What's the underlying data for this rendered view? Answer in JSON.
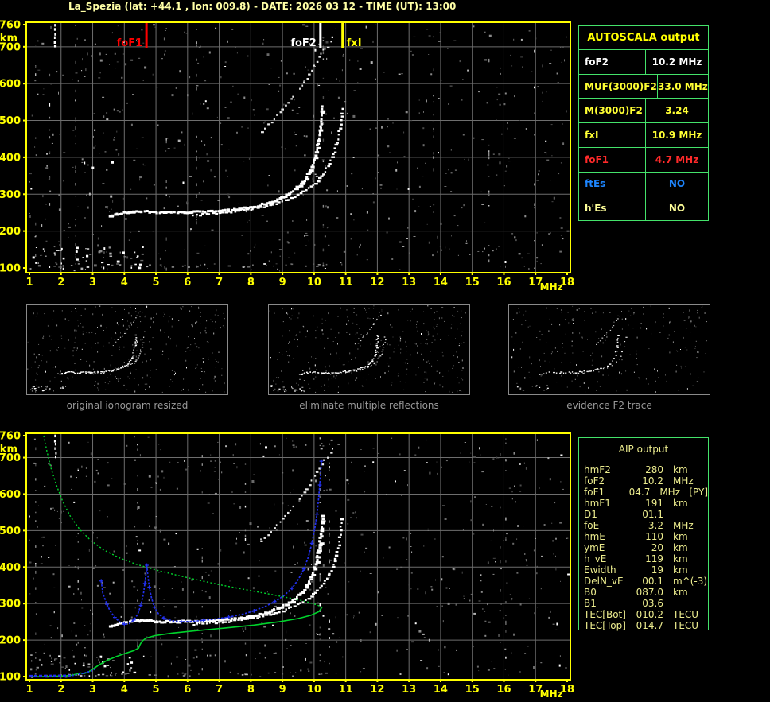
{
  "title": "La_Spezia (lat: +44.1 , lon: 009.8) - DATE: 2026 03 12 - TIME (UT): 13:00",
  "colors": {
    "title": "#ffffa6",
    "axis_labels": "#ffff00",
    "plot_border": "#ffff00",
    "grid": "#6e6e6e",
    "noise_palette": [
      "#4a4a4a",
      "#6a6a6a",
      "#8a8a8a",
      "#b4b4b4",
      "#ffffff"
    ],
    "trace_white": "#ffffff",
    "profile_green": "#00d42c",
    "scaled_trace_blue": "#2230ee",
    "table_border_green": "#44e26a",
    "caption_gray": "#9a9a9a"
  },
  "autoscala_table": {
    "title": "AUTOSCALA output",
    "rows": [
      {
        "label": "foF2",
        "value": "10.2 MHz",
        "color": "#ffffff"
      },
      {
        "label": "MUF(3000)F2",
        "value": "33.0 MHz",
        "color": "#ffff33"
      },
      {
        "label": "M(3000)F2",
        "value": "3.24",
        "color": "#ffff33"
      },
      {
        "label": "fxI",
        "value": "10.9 MHz",
        "color": "#ffff33"
      },
      {
        "label": "foF1",
        "value": "4.7 MHz",
        "color": "#ff2a2a"
      },
      {
        "label": "ftEs",
        "value": "NO",
        "color": "#1e86ff"
      },
      {
        "label": "h'Es",
        "value": "NO",
        "color": "#ffff99"
      }
    ]
  },
  "aip_table": {
    "title": "AIP output",
    "rows": [
      {
        "label": "hmF2",
        "value": "280",
        "unit": "km",
        "note": ""
      },
      {
        "label": "foF2",
        "value": "10.2",
        "unit": "MHz",
        "note": ""
      },
      {
        "label": "foF1",
        "value": "04.7",
        "unit": "MHz",
        "note": "[PY]"
      },
      {
        "label": "hmF1",
        "value": "191",
        "unit": "km",
        "note": ""
      },
      {
        "label": "D1",
        "value": "01.1",
        "unit": "",
        "note": ""
      },
      {
        "label": "foE",
        "value": "3.2",
        "unit": "MHz",
        "note": ""
      },
      {
        "label": "hmE",
        "value": "110",
        "unit": "km",
        "note": ""
      },
      {
        "label": "ymE",
        "value": "20",
        "unit": "km",
        "note": ""
      },
      {
        "label": "h_vE",
        "value": "119",
        "unit": "km",
        "note": ""
      },
      {
        "label": "Ewidth",
        "value": "19",
        "unit": "km",
        "note": ""
      },
      {
        "label": "DelN_vE",
        "value": "00.1",
        "unit": "m^(-3)",
        "note": ""
      },
      {
        "label": "B0",
        "value": "087.0",
        "unit": "km",
        "note": ""
      },
      {
        "label": "B1",
        "value": "03.6",
        "unit": "",
        "note": ""
      },
      {
        "label": "TEC[Bot]",
        "value": "010.2",
        "unit": "TECU",
        "note": ""
      },
      {
        "label": "TEC[Top]",
        "value": "014.7",
        "unit": "TECU",
        "note": ""
      }
    ]
  },
  "thumbnails": [
    {
      "caption": "original ionogram resized"
    },
    {
      "caption": "eliminate multiple reflections"
    },
    {
      "caption": "evidence F2 trace"
    }
  ],
  "axes": {
    "x_ticks": [
      "1",
      "2",
      "3",
      "4",
      "5",
      "6",
      "7",
      "8",
      "9",
      "10",
      "11",
      "12",
      "13",
      "14",
      "15",
      "16",
      "17",
      "18"
    ],
    "x_unit": "MHz",
    "y_ticks": [
      "760",
      "700",
      "600",
      "500",
      "400",
      "300",
      "200",
      "100"
    ],
    "y_unit": "km"
  },
  "chart_data": {
    "type": "ionogram",
    "x_axis": {
      "label": "MHz",
      "range": [
        1,
        18
      ]
    },
    "y_axis": {
      "label": "km",
      "range": [
        100,
        760
      ]
    },
    "markers": [
      {
        "name": "foF1",
        "freq_mhz": 4.7,
        "color": "#ff0000",
        "label": "foF1",
        "side": "left"
      },
      {
        "name": "foF2",
        "freq_mhz": 10.2,
        "color": "#ffffff",
        "label": "foF2",
        "side": "left"
      },
      {
        "name": "fxI",
        "freq_mhz": 10.9,
        "color": "#ffff00",
        "label": "fxI",
        "side": "right"
      }
    ],
    "trace_o_mode": [
      [
        3.55,
        238
      ],
      [
        3.8,
        245
      ],
      [
        4.1,
        250
      ],
      [
        4.4,
        252
      ],
      [
        4.65,
        254
      ],
      [
        4.9,
        251
      ],
      [
        5.2,
        250
      ],
      [
        5.6,
        250
      ],
      [
        6.0,
        251
      ],
      [
        6.4,
        252
      ],
      [
        6.9,
        254
      ],
      [
        7.4,
        258
      ],
      [
        7.9,
        263
      ],
      [
        8.3,
        270
      ],
      [
        8.7,
        280
      ],
      [
        9.0,
        291
      ],
      [
        9.3,
        305
      ],
      [
        9.55,
        322
      ],
      [
        9.75,
        342
      ],
      [
        9.9,
        365
      ],
      [
        10.02,
        392
      ],
      [
        10.12,
        425
      ],
      [
        10.2,
        465
      ],
      [
        10.25,
        505
      ],
      [
        10.28,
        540
      ]
    ],
    "trace_x_mode": [
      [
        6.2,
        243
      ],
      [
        6.7,
        246
      ],
      [
        7.2,
        250
      ],
      [
        7.7,
        255
      ],
      [
        8.2,
        262
      ],
      [
        8.6,
        270
      ],
      [
        9.0,
        280
      ],
      [
        9.4,
        293
      ],
      [
        9.75,
        310
      ],
      [
        10.05,
        330
      ],
      [
        10.3,
        355
      ],
      [
        10.5,
        383
      ],
      [
        10.65,
        415
      ],
      [
        10.76,
        450
      ],
      [
        10.84,
        490
      ],
      [
        10.89,
        530
      ]
    ],
    "second_hop_streaks": [
      [
        [
          8.35,
          470
        ],
        [
          8.75,
          505
        ],
        [
          9.1,
          540
        ],
        [
          9.35,
          565
        ]
      ],
      [
        [
          9.55,
          585
        ],
        [
          9.85,
          625
        ],
        [
          10.1,
          660
        ],
        [
          10.3,
          692
        ]
      ],
      [
        [
          10.45,
          700
        ],
        [
          10.6,
          725
        ]
      ]
    ],
    "top_left_streak": [
      [
        1.82,
        700
      ],
      [
        1.82,
        758
      ]
    ],
    "profile_green_topside": [
      [
        1.45,
        760
      ],
      [
        1.55,
        718
      ],
      [
        1.68,
        672
      ],
      [
        1.85,
        625
      ],
      [
        2.05,
        580
      ],
      [
        2.3,
        538
      ],
      [
        2.6,
        502
      ],
      [
        2.95,
        472
      ],
      [
        3.35,
        447
      ],
      [
        3.85,
        425
      ],
      [
        4.4,
        407
      ],
      [
        5.0,
        392
      ],
      [
        5.65,
        378
      ],
      [
        6.35,
        364
      ],
      [
        7.1,
        350
      ],
      [
        7.9,
        337
      ],
      [
        8.7,
        324
      ],
      [
        9.35,
        313
      ],
      [
        9.8,
        304
      ],
      [
        10.1,
        296
      ],
      [
        10.25,
        290
      ]
    ],
    "profile_green_bottomside": [
      [
        10.25,
        290
      ],
      [
        10.15,
        278
      ],
      [
        9.9,
        268
      ],
      [
        9.5,
        259
      ],
      [
        8.9,
        250
      ],
      [
        8.1,
        241
      ],
      [
        7.2,
        233
      ],
      [
        6.3,
        226
      ],
      [
        5.5,
        219
      ],
      [
        4.95,
        212
      ],
      [
        4.68,
        205
      ],
      [
        4.56,
        197
      ],
      [
        4.5,
        188
      ],
      [
        4.45,
        178
      ],
      [
        4.3,
        171
      ],
      [
        4.05,
        164
      ],
      [
        3.75,
        155
      ],
      [
        3.45,
        144
      ],
      [
        3.2,
        132
      ],
      [
        3.0,
        120
      ],
      [
        2.85,
        112
      ],
      [
        2.72,
        108
      ],
      [
        2.6,
        110
      ],
      [
        2.5,
        107
      ],
      [
        2.35,
        104
      ],
      [
        2.15,
        102
      ],
      [
        1.8,
        101
      ],
      [
        1.4,
        100
      ],
      [
        1.05,
        100
      ]
    ],
    "scaled_trace_blue": [
      [
        3.27,
        362
      ],
      [
        3.32,
        328
      ],
      [
        3.45,
        298
      ],
      [
        3.55,
        280
      ],
      [
        3.7,
        262
      ],
      [
        3.85,
        250
      ],
      [
        4.0,
        243
      ],
      [
        4.15,
        245
      ],
      [
        4.3,
        255
      ],
      [
        4.42,
        270
      ],
      [
        4.52,
        295
      ],
      [
        4.6,
        325
      ],
      [
        4.65,
        355
      ],
      [
        4.69,
        385
      ],
      [
        4.71,
        405
      ],
      [
        4.74,
        380
      ],
      [
        4.79,
        345
      ],
      [
        4.86,
        315
      ],
      [
        4.95,
        290
      ],
      [
        5.08,
        272
      ],
      [
        5.25,
        260
      ],
      [
        5.5,
        253
      ],
      [
        5.8,
        250
      ],
      [
        6.1,
        251
      ],
      [
        6.5,
        254
      ],
      [
        6.9,
        258
      ],
      [
        7.3,
        263
      ],
      [
        7.7,
        270
      ],
      [
        8.1,
        280
      ],
      [
        8.45,
        292
      ],
      [
        8.75,
        305
      ],
      [
        9.05,
        322
      ],
      [
        9.3,
        342
      ],
      [
        9.5,
        366
      ],
      [
        9.68,
        395
      ],
      [
        9.82,
        428
      ],
      [
        9.93,
        465
      ],
      [
        10.02,
        505
      ],
      [
        10.09,
        545
      ],
      [
        10.14,
        585
      ],
      [
        10.18,
        625
      ],
      [
        10.21,
        660
      ],
      [
        10.23,
        690
      ]
    ],
    "blue_e_segment": [
      [
        1.0,
        101
      ],
      [
        2.3,
        102
      ]
    ],
    "blue_e_rise": [
      [
        2.35,
        103
      ],
      [
        2.55,
        106
      ],
      [
        2.75,
        110
      ],
      [
        2.95,
        115
      ],
      [
        3.1,
        122
      ]
    ]
  }
}
